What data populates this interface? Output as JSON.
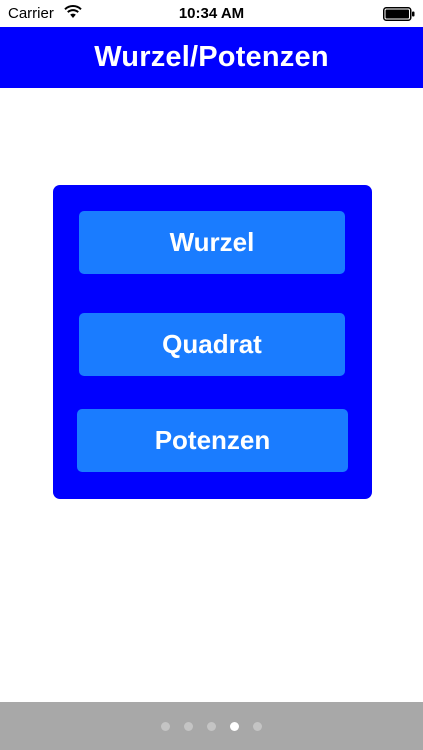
{
  "status_bar": {
    "carrier": "Carrier",
    "time": "10:34 AM",
    "wifi_icon": "wifi-icon",
    "battery_icon": "battery-icon"
  },
  "nav_bar": {
    "title": "Wurzel/Potenzen"
  },
  "menu": {
    "buttons": [
      {
        "label": "Wurzel"
      },
      {
        "label": "Quadrat"
      },
      {
        "label": "Potenzen"
      }
    ]
  },
  "page_control": {
    "page_count": 5,
    "current_page": 4
  },
  "colors": {
    "nav_background": "#0000ff",
    "panel_background": "#0000ff",
    "button_background": "#1a7cff",
    "button_text": "#ffffff",
    "bottom_bar": "#a8a8a8"
  }
}
